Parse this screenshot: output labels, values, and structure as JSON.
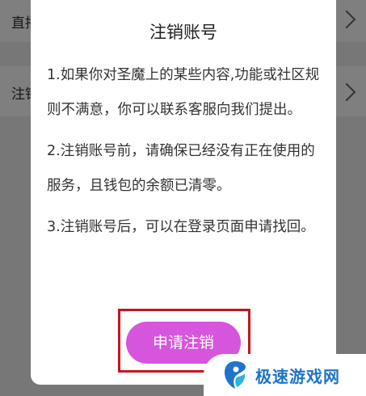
{
  "background": {
    "rows": [
      {
        "label": "直播"
      },
      {
        "label": "注销"
      }
    ]
  },
  "dialog": {
    "title": "注销账号",
    "paragraphs": [
      "1.如果你对圣魔上的某些内容,功能或社区规则不满意，你可以联系客服向我们提出。",
      "2.注销账号前，请确保已经没有正在使用的服务，且钱包的余额已清零。",
      "3.注销账号后，可以在登录页面申请找回。"
    ],
    "apply_button_label": "申请注销"
  },
  "watermark": {
    "text": "极速游戏网"
  },
  "colors": {
    "button": "#d556dc",
    "highlight": "#c4161c",
    "watermark_text": "#1f73c8"
  }
}
